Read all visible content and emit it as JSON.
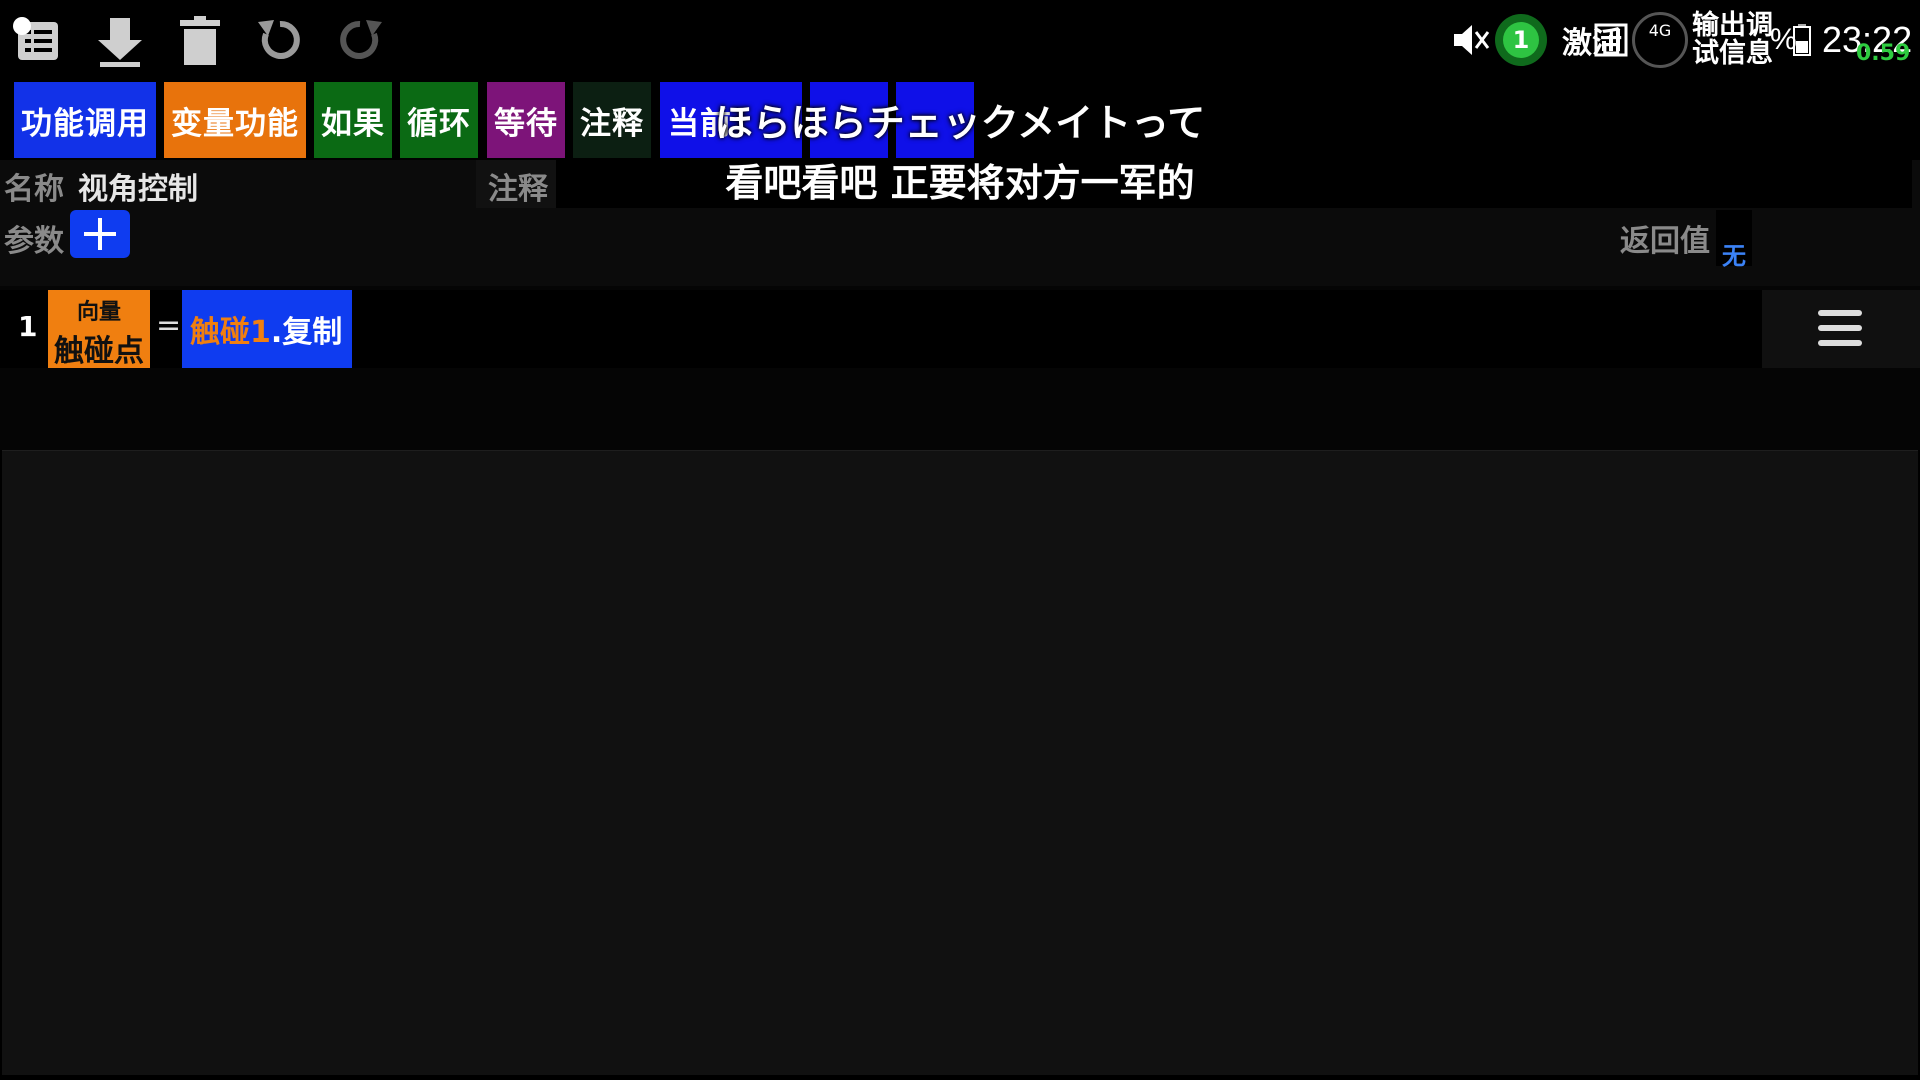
{
  "toolbar": {
    "icons": [
      "list-icon",
      "download-icon",
      "trash-icon",
      "undo-icon",
      "redo-icon"
    ]
  },
  "status_bar": {
    "notification_count": "1",
    "network": "4G",
    "carrier_text": "激活",
    "output_line1": "输出调",
    "output_line2": "试信息",
    "battery_percent": "%",
    "time": "23:22",
    "speed": "0.59"
  },
  "palette": {
    "items": [
      {
        "label": "功能调用",
        "color": "#1232e8"
      },
      {
        "label": "变量功能",
        "color": "#e8730c"
      },
      {
        "label": "如果",
        "color": "#0b6a14"
      },
      {
        "label": "循环",
        "color": "#0b6a14"
      },
      {
        "label": "等待",
        "color": "#7d1479"
      },
      {
        "label": "注释",
        "color": "#0c1f12"
      },
      {
        "label": "当前",
        "color": "#0f10e8"
      },
      {
        "label": "",
        "color": "#0f10e8"
      },
      {
        "label": "",
        "color": "#0f10e8"
      }
    ]
  },
  "subtitle": {
    "line1": "ほらほらチェックメイトって",
    "line2": "看吧看吧 正要将对方一军的"
  },
  "function": {
    "name_label": "名称",
    "name_value": "视角控制",
    "comment_label": "注释",
    "params_label": "参数",
    "return_label": "返回值",
    "return_value": "无"
  },
  "code_line": {
    "number": "1",
    "var_type": "向量",
    "var_name": "触碰点",
    "operator": "=",
    "value_prefix": "触碰1",
    "value_suffix": ".复制"
  },
  "colors": {
    "orange": "#f07f10",
    "blue": "#0f3cf0",
    "return_blue": "#3b82f6"
  }
}
